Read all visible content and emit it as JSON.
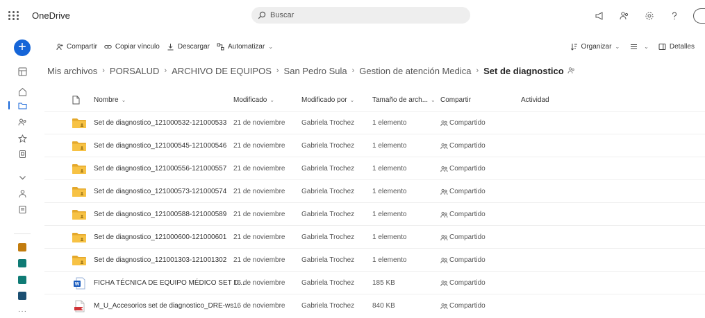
{
  "app": {
    "title": "OneDrive"
  },
  "search": {
    "placeholder": "Buscar"
  },
  "commands": {
    "share": "Compartir",
    "copy_link": "Copiar vínculo",
    "download": "Descargar",
    "automate": "Automatizar",
    "organize": "Organizar",
    "view_chevron": "⌄",
    "details": "Detalles"
  },
  "breadcrumb": {
    "items": [
      "Mis archivos",
      "PORSALUD",
      "ARCHIVO DE EQUIPOS",
      "San Pedro Sula",
      "Gestion de atención Medica"
    ],
    "current": "Set de diagnostico"
  },
  "table": {
    "columns": {
      "name": "Nombre",
      "modified": "Modificado",
      "modified_by": "Modificado por",
      "size": "Tamaño de arch...",
      "share": "Compartir",
      "activity": "Actividad"
    },
    "rows": [
      {
        "type": "folder",
        "name": "Set de diagnostico_121000532-121000533",
        "modified": "21 de noviembre",
        "modified_by": "Gabriela Trochez",
        "size": "1 elemento",
        "share": "Compartido"
      },
      {
        "type": "folder",
        "name": "Set de diagnostico_121000545-121000546",
        "modified": "21 de noviembre",
        "modified_by": "Gabriela Trochez",
        "size": "1 elemento",
        "share": "Compartido"
      },
      {
        "type": "folder",
        "name": "Set de diagnostico_121000556-121000557",
        "modified": "21 de noviembre",
        "modified_by": "Gabriela Trochez",
        "size": "1 elemento",
        "share": "Compartido"
      },
      {
        "type": "folder",
        "name": "Set de diagnostico_121000573-121000574",
        "modified": "21 de noviembre",
        "modified_by": "Gabriela Trochez",
        "size": "1 elemento",
        "share": "Compartido"
      },
      {
        "type": "folder",
        "name": "Set de diagnostico_121000588-121000589",
        "modified": "21 de noviembre",
        "modified_by": "Gabriela Trochez",
        "size": "1 elemento",
        "share": "Compartido"
      },
      {
        "type": "folder",
        "name": "Set de diagnostico_121000600-121000601",
        "modified": "21 de noviembre",
        "modified_by": "Gabriela Trochez",
        "size": "1 elemento",
        "share": "Compartido"
      },
      {
        "type": "folder",
        "name": "Set de diagnostico_121001303-121001302",
        "modified": "21 de noviembre",
        "modified_by": "Gabriela Trochez",
        "size": "1 elemento",
        "share": "Compartido"
      },
      {
        "type": "word",
        "name": "FICHA TÉCNICA DE EQUIPO MÉDICO SET D...",
        "modified": "16 de noviembre",
        "modified_by": "Gabriela Trochez",
        "size": "185 KB",
        "share": "Compartido"
      },
      {
        "type": "pdf",
        "name": "M_U_Accesorios set de diagnostico_DRE-ws...",
        "modified": "16 de noviembre",
        "modified_by": "Gabriela Trochez",
        "size": "840 KB",
        "share": "Compartido"
      }
    ]
  },
  "colors": {
    "accent": "#1565d8",
    "folder": "#f7c244",
    "folder_back": "#e4a82b",
    "word": "#185abd",
    "pdf_red": "#d13438"
  },
  "icons": [
    "waffle-icon",
    "search-icon",
    "megaphone-icon",
    "people-icon",
    "settings-icon",
    "help-icon",
    "new-icon",
    "home-icon",
    "folder-icon",
    "shared-icon",
    "favorites-icon",
    "recycle-bin-icon",
    "chevron-down-icon",
    "people-icon",
    "library-icon",
    "share-icon",
    "link-icon",
    "download-icon",
    "automate-icon",
    "sort-icon",
    "view-icon",
    "details-icon",
    "file-icon"
  ]
}
